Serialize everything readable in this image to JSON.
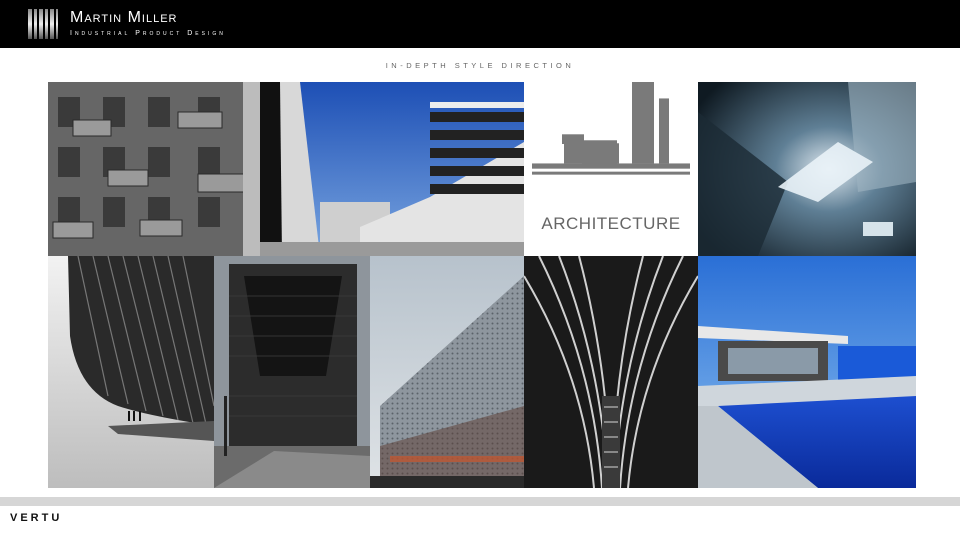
{
  "header": {
    "brand_name": "Martin Miller",
    "brand_subtitle": "Industrial Product Design",
    "logo_icon": "striped-bars-logo-icon"
  },
  "page": {
    "subtitle": "IN-DEPTH STYLE DIRECTION"
  },
  "collage": {
    "category_label": "ARCHITECTURE",
    "category_icon": "city-skyline-icon",
    "images": [
      {
        "name": "balconies-facade-photo"
      },
      {
        "name": "white-building-blue-sky-photo"
      },
      {
        "name": "concrete-lightwell-photo"
      },
      {
        "name": "curved-slatted-structure-photo"
      },
      {
        "name": "dark-monolith-building-photo"
      },
      {
        "name": "perforated-metal-facade-photo"
      },
      {
        "name": "escalator-perspective-photo"
      },
      {
        "name": "infinity-pool-villa-photo"
      }
    ]
  },
  "footer": {
    "brand": "VERTU"
  },
  "colors": {
    "header_bg": "#000000",
    "text_gray": "#666666",
    "footer_bar": "#d6d6d6"
  }
}
